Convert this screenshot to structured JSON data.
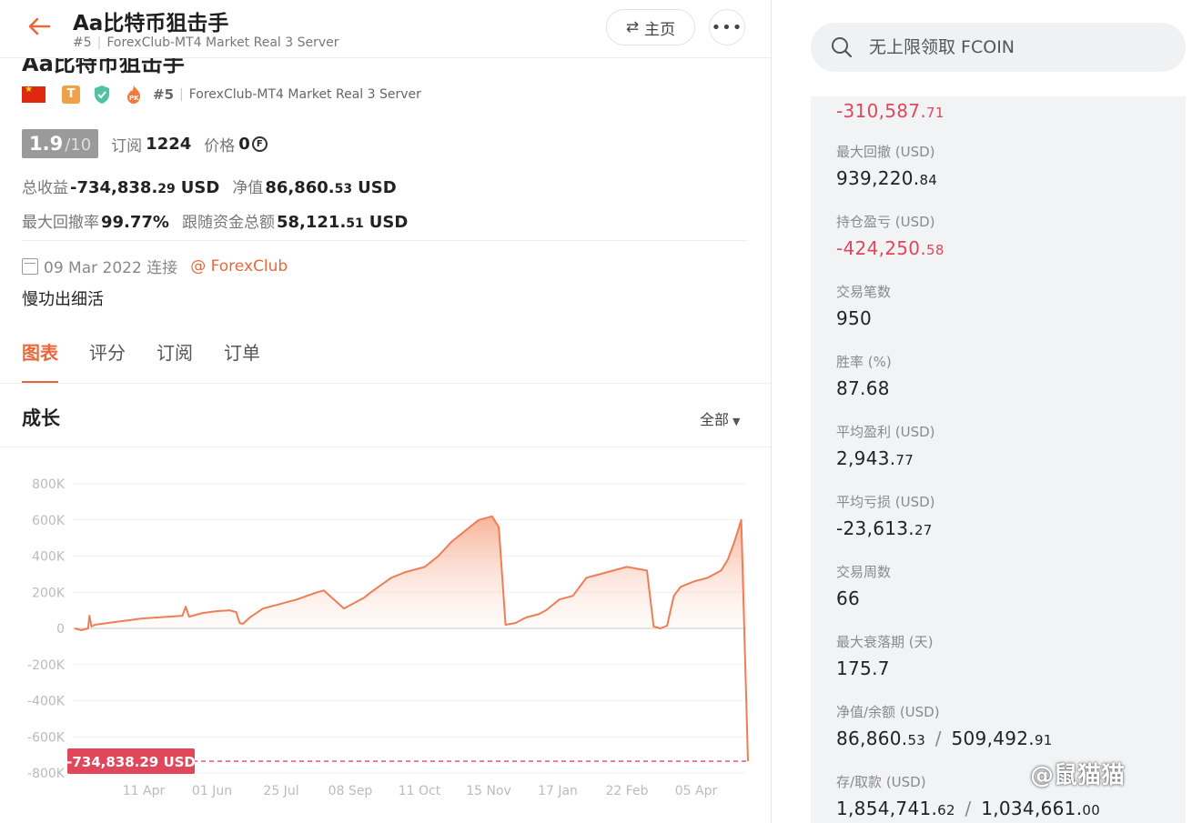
{
  "header": {
    "title": "Aa比特币狙击手",
    "rank": "#5",
    "server": "ForexClub-MT4 Market Real 3 Server",
    "home_label": "主页",
    "more_label": "•••"
  },
  "profile": {
    "title": "Aa比特币狙击手",
    "rank": "#5",
    "server": "ForexClub-MT4 Market Real 3 Server",
    "badges": [
      "china-flag-icon",
      "t-badge-icon",
      "verified-shield-icon",
      "pk-flame-icon"
    ],
    "score": "1.9",
    "score_max": "/10",
    "subscriptions_label": "订阅",
    "subscriptions": "1224",
    "price_label": "价格",
    "price": "0",
    "coin_symbol": "F",
    "total_profit_label": "总收益",
    "total_profit_int": "-734,838.",
    "total_profit_dec": "29",
    "equity_label": "净值",
    "equity_int": "86,860.",
    "equity_dec": "53",
    "currency": "USD",
    "max_drawdown_label": "最大回撤率",
    "max_drawdown": "99.77%",
    "follow_funds_label": "跟随资金总额",
    "follow_funds_int": "58,121.",
    "follow_funds_dec": "51",
    "connected_date": "09 Mar 2022 连接",
    "broker": "@ ForexClub",
    "bio": "慢功出细活"
  },
  "tabs": [
    {
      "label": "图表",
      "active": true
    },
    {
      "label": "评分",
      "active": false
    },
    {
      "label": "订阅",
      "active": false
    },
    {
      "label": "订单",
      "active": false
    }
  ],
  "growth": {
    "title": "成长",
    "range_label": "全部"
  },
  "chart_data": {
    "type": "area",
    "title": "成长",
    "xlabel": "",
    "ylabel": "",
    "x_ticks": [
      "11 Apr",
      "01 Jun",
      "25 Jul",
      "08 Sep",
      "11 Oct",
      "15 Nov",
      "17 Jan",
      "22 Feb",
      "05 Apr"
    ],
    "y_ticks": [
      "800K",
      "600K",
      "400K",
      "200K",
      "0",
      "-200K",
      "-400K",
      "-600K",
      "-800K"
    ],
    "ylim": [
      -800000,
      800000
    ],
    "current_value_label": "-734,838.29 USD",
    "current_value": -734838.29,
    "colors": {
      "line": "#ef7d55",
      "fill": "#f7c2ad",
      "marker": "#e0475a"
    },
    "series": [
      {
        "x_frac": [
          0.0,
          0.01,
          0.02,
          0.022,
          0.025,
          0.03,
          0.04,
          0.06,
          0.08,
          0.1,
          0.12,
          0.14,
          0.16,
          0.165,
          0.17,
          0.19,
          0.21,
          0.23,
          0.24,
          0.245,
          0.25,
          0.26,
          0.28,
          0.3,
          0.33,
          0.36,
          0.37,
          0.4,
          0.43,
          0.44,
          0.47,
          0.49,
          0.52,
          0.54,
          0.56,
          0.58,
          0.6,
          0.62,
          0.63,
          0.64,
          0.655,
          0.66,
          0.67,
          0.69,
          0.7,
          0.72,
          0.74,
          0.76,
          0.78,
          0.8,
          0.82,
          0.85,
          0.86,
          0.87,
          0.88,
          0.885,
          0.89,
          0.9,
          0.92,
          0.94,
          0.96,
          0.97,
          0.98,
          0.985,
          0.99,
          1.0
        ],
        "values": [
          0,
          -10000,
          0,
          70000,
          10000,
          20000,
          25000,
          35000,
          45000,
          55000,
          60000,
          65000,
          70000,
          120000,
          65000,
          85000,
          95000,
          100000,
          90000,
          30000,
          25000,
          60000,
          110000,
          130000,
          160000,
          200000,
          210000,
          110000,
          170000,
          200000,
          280000,
          310000,
          340000,
          400000,
          480000,
          540000,
          600000,
          620000,
          560000,
          20000,
          30000,
          40000,
          60000,
          80000,
          100000,
          160000,
          180000,
          280000,
          300000,
          320000,
          340000,
          320000,
          10000,
          0,
          15000,
          100000,
          180000,
          230000,
          260000,
          280000,
          320000,
          380000,
          480000,
          540000,
          600000,
          -734838
        ]
      }
    ]
  },
  "search": {
    "placeholder": "无上限领取 FCOIN"
  },
  "stats": [
    {
      "label": "",
      "int": "-310,587.",
      "dec": "71",
      "negative": true
    },
    {
      "label": "最大回撤 (USD)",
      "int": "939,220.",
      "dec": "84",
      "negative": false
    },
    {
      "label": "持仓盈亏 (USD)",
      "int": "-424,250.",
      "dec": "58",
      "negative": true
    },
    {
      "label": "交易笔数",
      "int": "950",
      "dec": "",
      "negative": false
    },
    {
      "label": "胜率 (%)",
      "int": "87.68",
      "dec": "",
      "negative": false
    },
    {
      "label": "平均盈利 (USD)",
      "int": "2,943.",
      "dec": "77",
      "negative": false
    },
    {
      "label": "平均亏损 (USD)",
      "int": "-23,613.",
      "dec": "27",
      "negative": false
    },
    {
      "label": "交易周数",
      "int": "66",
      "dec": "",
      "negative": false
    },
    {
      "label": "最大衰落期 (天)",
      "int": "175.7",
      "dec": "",
      "negative": false
    },
    {
      "label": "净值/余额 (USD)",
      "int": "86,860.",
      "dec": "53",
      "int2": "509,492.",
      "dec2": "91",
      "negative": false
    },
    {
      "label": "存/取款 (USD)",
      "int": "1,854,741.",
      "dec": "62",
      "int2": "1,034,661.",
      "dec2": "00",
      "negative": false
    }
  ],
  "watermark": "@鼠猫猫"
}
